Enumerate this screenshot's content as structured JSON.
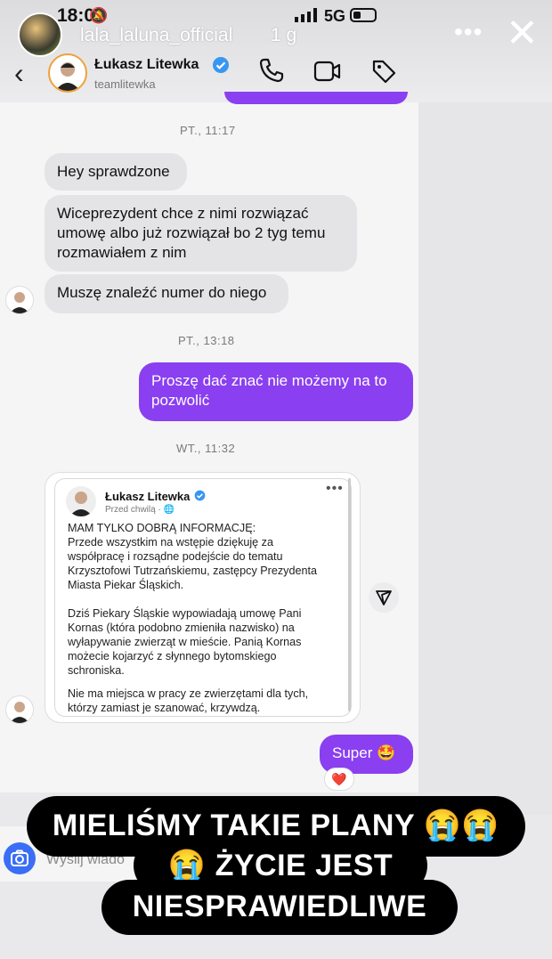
{
  "status_bar": {
    "time": "18:08",
    "network": "5G"
  },
  "story": {
    "username": "lala_laluna_official",
    "age": "1 g",
    "more": "•••",
    "close": "✕"
  },
  "chat_header": {
    "back": "‹",
    "name": "Łukasz Litewka",
    "handle": "teamlitewka"
  },
  "chat": {
    "timestamp_1": "PT., 11:17",
    "msg_1": "Hey sprawdzone",
    "msg_2_lines": [
      "Wiceprezydent chce z nimi rozwiązać",
      "umowę albo już rozwiązał bo 2 tyg temu",
      "rozmawiałem z nim"
    ],
    "msg_3": "Muszę znaleźć numer do niego",
    "timestamp_2": "PT., 13:18",
    "msg_4_lines": [
      "Proszę dać znać nie możemy na to",
      "pozwolić"
    ],
    "timestamp_3": "WT., 11:32",
    "msg_5": "Super 🤩",
    "reaction": "❤️"
  },
  "shared_post": {
    "author": "Łukasz Litewka",
    "meta": "Przed chwilą · 🌐",
    "more": "•••",
    "lines": [
      "MAM TYLKO DOBRĄ INFORMACJĘ:",
      "Przede wszystkim na wstępie dziękuję za",
      "współpracę i rozsądne podejście do tematu",
      "Krzysztofowi Tutrzańskiemu, zastępcy Prezydenta",
      "Miasta Piekar Śląskich.",
      "",
      "Dziś Piekary Śląskie wypowiadają umowę Pani",
      "Kornas (która podobno zmieniła nazwisko) na",
      "wyłapywanie zwierząt w mieście. Panią Kornas",
      "możecie kojarzyć z słynnego bytomskiego",
      "schroniska.",
      "",
      "Nie ma miejsca w pracy ze zwierzętami dla tych,",
      "którzy zamiast je szanować, krzywdzą."
    ]
  },
  "composer": {
    "placeholder": "Wyślij wiado"
  },
  "captions": {
    "line_1": "MIELIŚMY  TAKIE PLANY 😭😭",
    "line_2": "😭  ŻYCIE JEST",
    "line_3": "NIESPRAWIEDLIWE"
  },
  "colors": {
    "outgoing_bubble": "#8a3ff0",
    "incoming_bubble": "#e4e4e7",
    "verified": "#3897f0",
    "camera_button": "#3b6ef6"
  }
}
